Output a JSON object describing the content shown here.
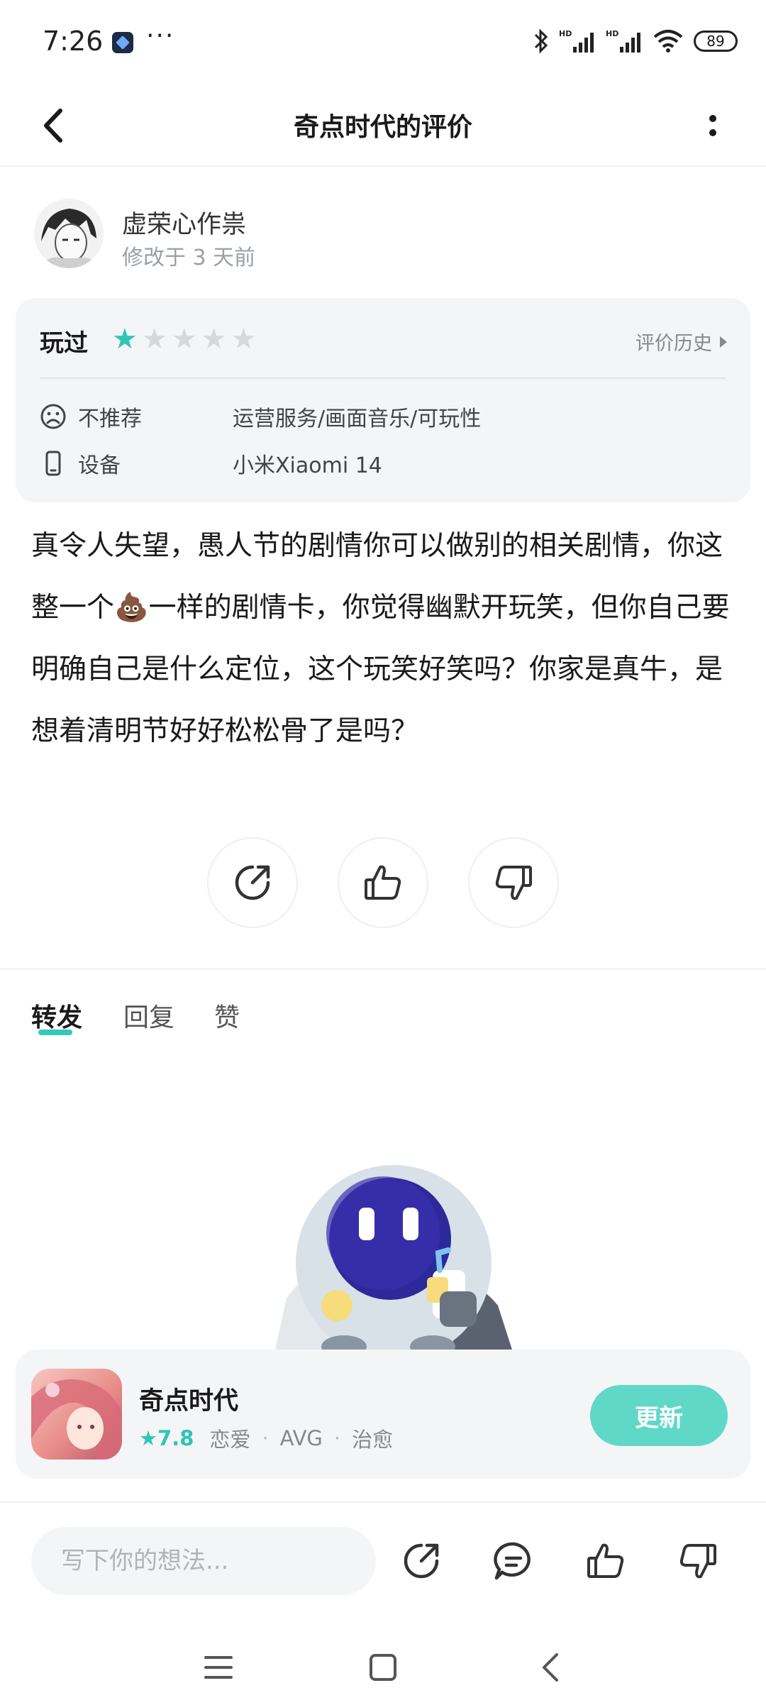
{
  "status_bar": {
    "time": "7:26",
    "dots": "···",
    "battery": "89",
    "icons": [
      "telegram-icon",
      "bluetooth-icon",
      "signal-hd-icon",
      "signal-hd-icon",
      "wifi-icon",
      "battery-icon"
    ]
  },
  "header": {
    "title": "奇点时代的评价",
    "back_icon": "chevron-left-icon",
    "more_icon": "more-vertical-icon"
  },
  "author": {
    "name": "虚荣心作祟",
    "time": "修改于 3 天前"
  },
  "rating_card": {
    "played_label": "玩过",
    "stars_filled": 1,
    "stars_total": 5,
    "history_label": "评价历史",
    "recommend_label": "不推荐",
    "recommend_value": "运营服务/画面音乐/可玩性",
    "device_label": "设备",
    "device_value": "小米Xiaomi 14"
  },
  "review": {
    "part1": "真令人失望，愚人节的剧情你可以做别的相关剧情，你这整一个",
    "emoji": "💩",
    "part2": "一样的剧情卡，你觉得幽默开玩笑，但你自己要明确自己是什么定位，这个玩笑好笑吗？你家是真牛，是想着清明节好好松松骨了是吗？"
  },
  "tabs": [
    {
      "label": "转发",
      "active": true
    },
    {
      "label": "回复",
      "active": false
    },
    {
      "label": "赞",
      "active": false
    }
  ],
  "app_card": {
    "name": "奇点时代",
    "score": "7.8",
    "tag1": "恋爱",
    "tag2": "AVG",
    "tag3": "治愈",
    "separator": "·",
    "update_label": "更新"
  },
  "bottom_bar": {
    "input_placeholder": "写下你的想法..."
  },
  "colors": {
    "accent": "#2fc5b4",
    "button": "#5fd8c8",
    "card_bg": "#f4f5f7"
  }
}
